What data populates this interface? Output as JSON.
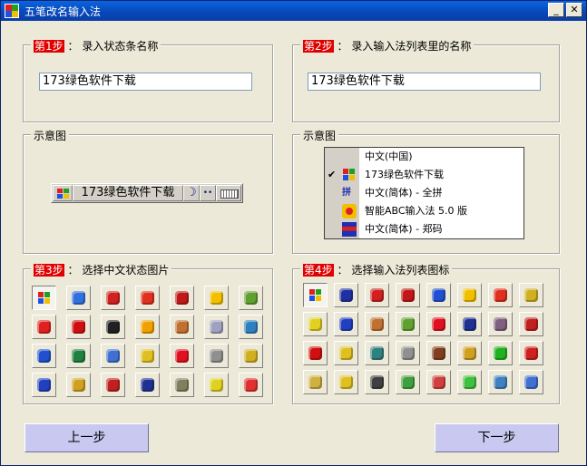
{
  "window": {
    "title": "五笔改名输入法",
    "minimize_glyph": "_",
    "close_glyph": "✕"
  },
  "step1": {
    "tag": "第1步",
    "colon": "：",
    "label": "录入状态条名称",
    "value": "173绿色软件下载"
  },
  "step2": {
    "tag": "第2步",
    "colon": "：",
    "label": "录入输入法列表里的名称",
    "value": "173绿色软件下载"
  },
  "preview1": {
    "label": "示意图",
    "bar_text": "173绿色软件下载",
    "moon": "☽",
    "dots": "••"
  },
  "preview2": {
    "label": "示意图",
    "items": [
      {
        "label": "中文(中国)",
        "checked": false,
        "icon": "none"
      },
      {
        "label": "173绿色软件下载",
        "checked": true,
        "icon": "windows-flag-icon"
      },
      {
        "label": "中文(简体) - 全拼",
        "checked": false,
        "icon": "pinyin-icon"
      },
      {
        "label": "智能ABC输入法 5.0 版",
        "checked": false,
        "icon": "abc-icon"
      },
      {
        "label": "中文(简体) - 郑码",
        "checked": false,
        "icon": "zhengma-icon"
      }
    ],
    "check_glyph": "✔"
  },
  "step3": {
    "tag": "第3步",
    "colon": "：",
    "label": "选择中文状态图片",
    "icons": [
      "windows-flag-icon",
      "colorful-flag-icon",
      "red-seal-icon",
      "red-zhong-icon",
      "red-flower-icon",
      "sunglasses-face-icon",
      "apple-icon",
      "eye-icon",
      "red-flag-icon",
      "penguin-icon",
      "warning-icon",
      "house-icon",
      "cd-icon",
      "book-icon",
      "blue-blob-icon",
      "globe-icon",
      "pointer-ball-icon",
      "coin-icon",
      "heart-icon",
      "devil-mask-icon",
      "star-gear-icon",
      "lightning-icon",
      "rabbit-icon",
      "red-book-icon",
      "moon-icon",
      "monitor-icon",
      "bucket-icon",
      "mushroom-icon"
    ]
  },
  "step4": {
    "tag": "第4步",
    "colon": "：",
    "label": "选择输入法列表图标",
    "icons": [
      "windows-flag-icon",
      "wu-character-icon",
      "red-seal-icon",
      "red-flower-icon",
      "blue-blob-icon",
      "sunglasses-face-icon",
      "red-zhong-icon",
      "star-gear-icon",
      "bucket-icon",
      "lightning-icon",
      "house-icon",
      "apple-icon",
      "heart-icon",
      "moon-icon",
      "cat-face-icon",
      "red-book-icon",
      "red-flag-icon",
      "coin-icon",
      "toolbox-icon",
      "devil-mask-icon",
      "pickaxe-icon",
      "rabbit-icon",
      "green-flower-icon",
      "lock-box-icon",
      "phone-icon",
      "padlock-icon",
      "printer-icon",
      "notepad-icon",
      "calculator-icon",
      "green-page-icon",
      "open-book-icon",
      "pointer-ball-icon"
    ]
  },
  "nav": {
    "prev": "上一步",
    "next": "下一步"
  }
}
